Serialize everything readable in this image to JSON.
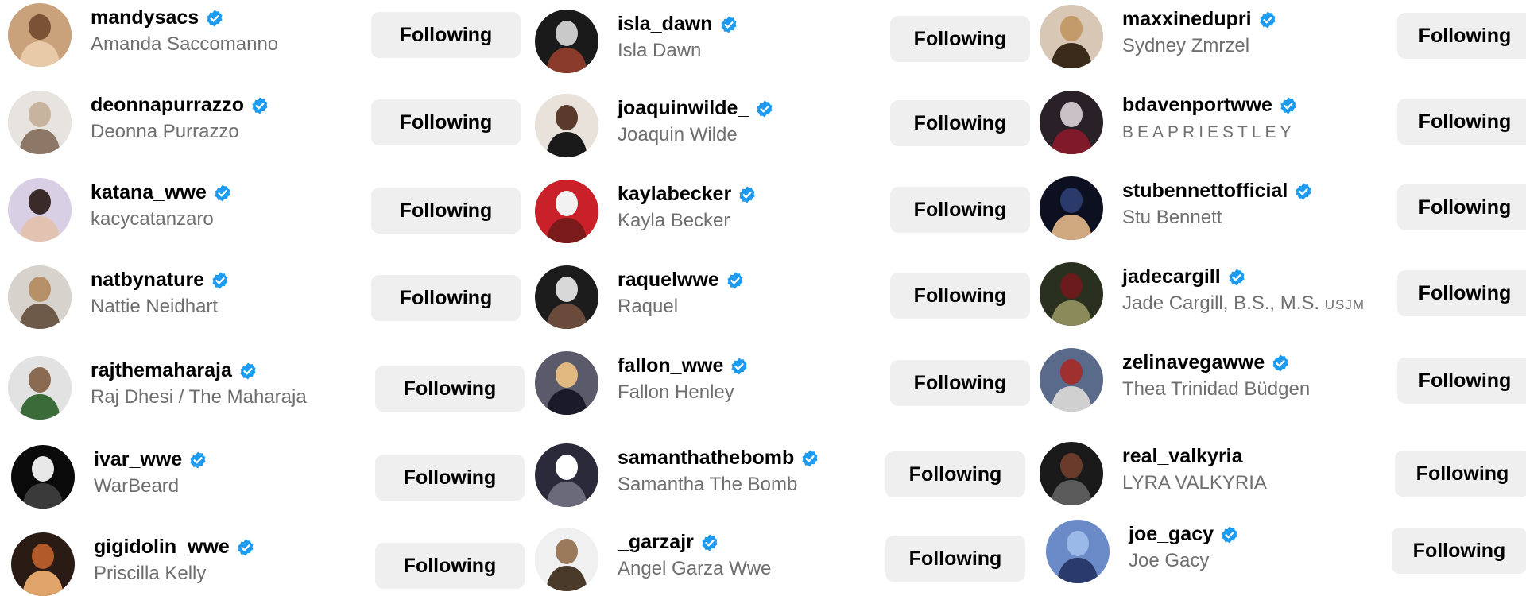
{
  "follow_label": "Following",
  "colors": {
    "verified_badge": "#1d9bf0",
    "button_bg": "#efefef",
    "secondary_text": "#6f6f6f"
  },
  "columns": [
    {
      "accounts": [
        {
          "username": "mandysacs",
          "full_name": "Amanda Saccomanno",
          "verified": true
        },
        {
          "username": "deonnapurrazzo",
          "full_name": "Deonna Purrazzo",
          "verified": true
        },
        {
          "username": "katana_wwe",
          "full_name": "kacycatanzaro",
          "verified": true
        },
        {
          "username": "natbynature",
          "full_name": "Nattie Neidhart",
          "verified": true
        },
        {
          "username": "rajthemaharaja",
          "full_name": "Raj Dhesi / The Maharaja",
          "verified": true
        },
        {
          "username": "ivar_wwe",
          "full_name": "WarBeard",
          "verified": true
        },
        {
          "username": "gigidolin_wwe",
          "full_name": "Priscilla Kelly",
          "verified": true
        }
      ]
    },
    {
      "accounts": [
        {
          "username": "isla_dawn",
          "full_name": "Isla Dawn",
          "verified": true
        },
        {
          "username": "joaquinwilde_",
          "full_name": "Joaquin Wilde",
          "verified": true
        },
        {
          "username": "kaylabecker",
          "full_name": "Kayla Becker",
          "verified": true
        },
        {
          "username": "raquelwwe",
          "full_name": "Raquel",
          "verified": true
        },
        {
          "username": "fallon_wwe",
          "full_name": "Fallon Henley",
          "verified": true
        },
        {
          "username": "samanthathebomb",
          "full_name": "Samantha The Bomb",
          "verified": true
        },
        {
          "username": "_garzajr",
          "full_name": "Angel Garza Wwe",
          "verified": true
        }
      ]
    },
    {
      "accounts": [
        {
          "username": "maxxinedupri",
          "full_name": "Sydney Zmrzel",
          "verified": true
        },
        {
          "username": "bdavenportwwe",
          "full_name": "BEAPRIESTLEY",
          "verified": true
        },
        {
          "username": "stubennettofficial",
          "full_name": "Stu Bennett",
          "verified": true
        },
        {
          "username": "jadecargill",
          "full_name": "Jade Cargill, B.S., M.S.",
          "name_suffix": "USJM",
          "verified": true
        },
        {
          "username": "zelinavegawwe",
          "full_name": "Thea Trinidad Büdgen",
          "verified": true
        },
        {
          "username": "real_valkyria",
          "full_name": "LYRA VALKYRIA",
          "verified": false
        },
        {
          "username": "joe_gacy",
          "full_name": "Joe Gacy",
          "verified": true
        }
      ]
    }
  ]
}
